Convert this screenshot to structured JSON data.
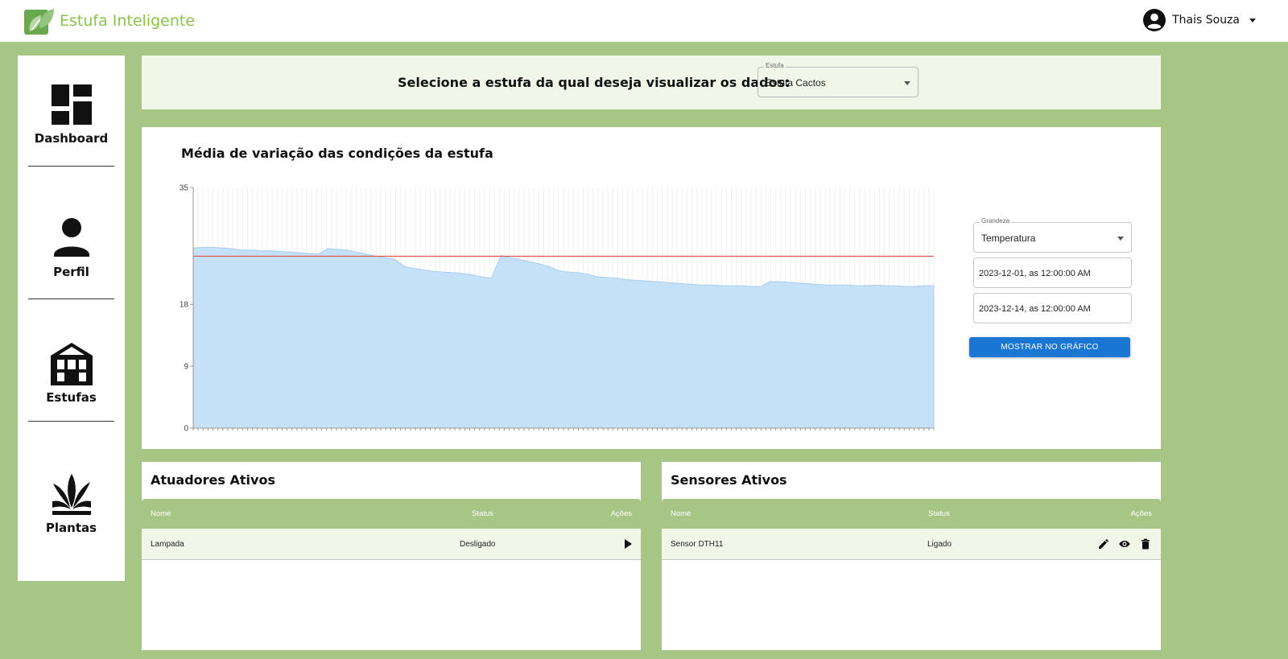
{
  "app": {
    "name": "Estufa Inteligente",
    "user_name": "Thais Souza"
  },
  "sidebar": {
    "items": [
      {
        "label": "Dashboard",
        "icon": "dashboard-icon"
      },
      {
        "label": "Perfil",
        "icon": "person-icon"
      },
      {
        "label": "Estufas",
        "icon": "greenhouse-icon"
      },
      {
        "label": "Plantas",
        "icon": "plant-icon"
      }
    ]
  },
  "selector": {
    "prompt": "Selecione a estufa da qual deseja visualizar os dados:",
    "legend": "Estufa",
    "value": "Estufa Cactos"
  },
  "chart_panel": {
    "title": "Média de variação das condições da estufa",
    "grandeza_legend": "Grandeza",
    "grandeza_value": "Temperatura",
    "start_date": "2023-12-01, as 12:00:00 AM",
    "end_date": "2023-12-14, as 12:00:00 AM",
    "button_label": "MOSTRAR NO GRÁFICO"
  },
  "chart_data": {
    "type": "area",
    "title": "Média de variação das condições da estufa",
    "xlabel": "",
    "ylabel": "",
    "ylim": [
      0,
      35
    ],
    "yticks": [
      0,
      9,
      18,
      35
    ],
    "grid": true,
    "series": [
      {
        "values": [
          26.2,
          26.3,
          26.3,
          26.2,
          26.1,
          25.9,
          25.9,
          25.8,
          25.8,
          25.7,
          25.6,
          25.5,
          25.4,
          25.3,
          26.1,
          26.0,
          25.9,
          25.6,
          25.3,
          25.0,
          24.8,
          24.5,
          23.5,
          23.2,
          23.0,
          22.8,
          22.7,
          22.6,
          22.5,
          22.3,
          22.0,
          21.8,
          25.1,
          24.8,
          24.5,
          24.2,
          23.9,
          23.5,
          22.9,
          22.7,
          22.6,
          22.4,
          22.0,
          21.9,
          21.8,
          21.6,
          21.5,
          21.4,
          21.3,
          21.2,
          21.1,
          21.0,
          20.9,
          20.8,
          20.8,
          20.7,
          20.7,
          20.7,
          20.6,
          20.6,
          21.3,
          21.3,
          21.2,
          21.1,
          21.0,
          20.9,
          20.8,
          20.8,
          20.8,
          20.7,
          20.7,
          20.8,
          20.7,
          20.7,
          20.6,
          20.6,
          20.7,
          20.7
        ]
      }
    ],
    "reference_line": 25.0,
    "area_color": "#c5e1f7",
    "line_color": "#e05050"
  },
  "actuators": {
    "title": "Atuadores Ativos",
    "columns": [
      "Nome",
      "Status",
      "Ações"
    ],
    "rows": [
      {
        "name": "Lampada",
        "status": "Desligado",
        "actions": [
          "play-icon"
        ]
      }
    ]
  },
  "sensors": {
    "title": "Sensores Ativos",
    "columns": [
      "Nome",
      "Status",
      "Ações"
    ],
    "rows": [
      {
        "name": "Sensor DTH11",
        "status": "Ligado",
        "actions": [
          "edit-icon",
          "view-icon",
          "delete-icon"
        ]
      }
    ]
  },
  "colors": {
    "background": "#a7c584",
    "panel_tint": "#f0f7e9",
    "brand": "#8bc34a",
    "primary_button": "#1976d2"
  }
}
